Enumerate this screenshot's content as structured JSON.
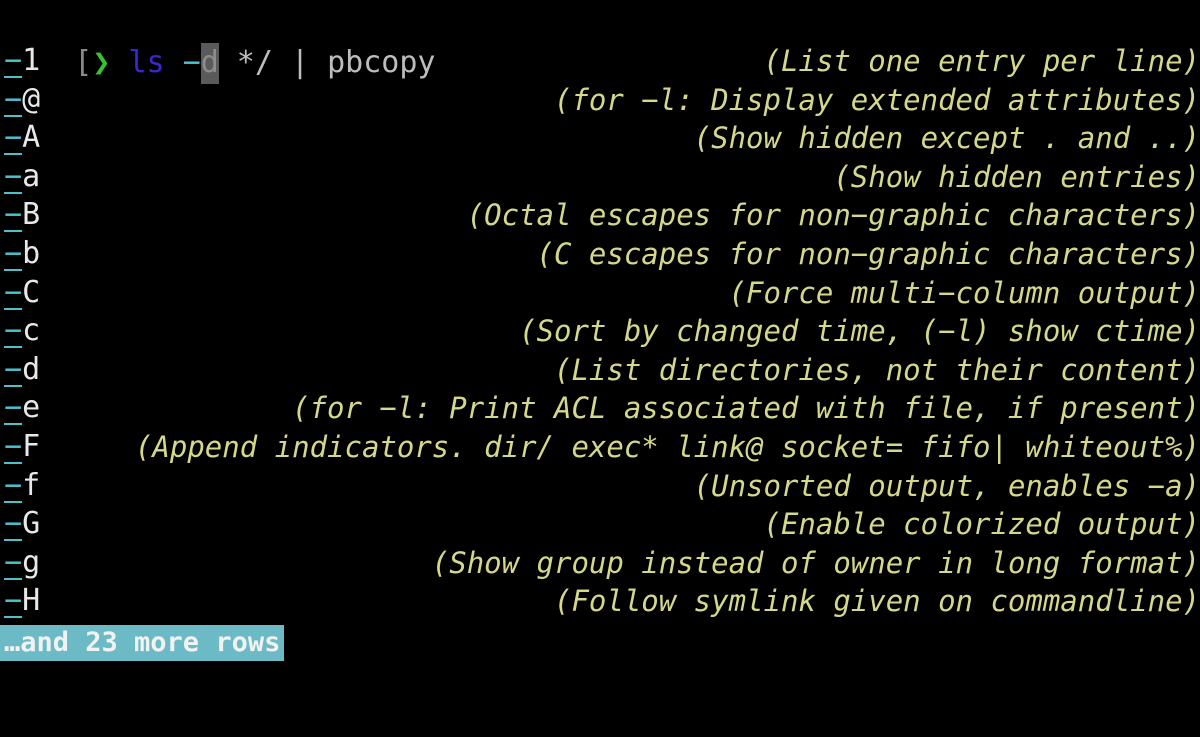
{
  "terminal": {
    "background_color": "#000000",
    "prompt": {
      "bracket": "[",
      "chevron": "❯",
      "command": "ls",
      "flag_dash": "−",
      "cursor_char": "d",
      "args": " */ | pbcopy",
      "colors": {
        "bracket": "#8a8a8a",
        "chevron": "#39c12f",
        "command": "#3a27d6",
        "dash": "#4ec0cd",
        "cursor_bg": "#5a5a5a",
        "cursor_fg": "#8c8c8c",
        "args": "#bdbdbd"
      }
    },
    "completion": {
      "option_dash": "−",
      "dash_color": "#4ec0cd",
      "letter_color": "#e8e8e8",
      "description_color": "#d5d88a",
      "rows": [
        {
          "option": "1",
          "description": "(List one entry per line)"
        },
        {
          "option": "@",
          "description": "(for −l: Display extended attributes)"
        },
        {
          "option": "A",
          "description": "(Show hidden except . and ..)"
        },
        {
          "option": "a",
          "description": "(Show hidden entries)"
        },
        {
          "option": "B",
          "description": "(Octal escapes for non−graphic characters)"
        },
        {
          "option": "b",
          "description": "(C escapes for non−graphic characters)"
        },
        {
          "option": "C",
          "description": "(Force multi−column output)"
        },
        {
          "option": "c",
          "description": "(Sort by changed time, (−l) show ctime)"
        },
        {
          "option": "d",
          "description": "(List directories, not their content)"
        },
        {
          "option": "e",
          "description": "(for −l: Print ACL associated with file, if present)"
        },
        {
          "option": "F",
          "description": "(Append indicators. dir/ exec* link@ socket= fifo| whiteout%)"
        },
        {
          "option": "f",
          "description": "(Unsorted output, enables −a)"
        },
        {
          "option": "G",
          "description": "(Enable colorized output)"
        },
        {
          "option": "g",
          "description": "(Show group instead of owner in long format)"
        },
        {
          "option": "H",
          "description": "(Follow symlink given on commandline)"
        }
      ]
    },
    "status_bar": {
      "text": "…and 23 more rows",
      "background_color": "#6cbac5",
      "text_color": "#f2f2f2"
    }
  }
}
